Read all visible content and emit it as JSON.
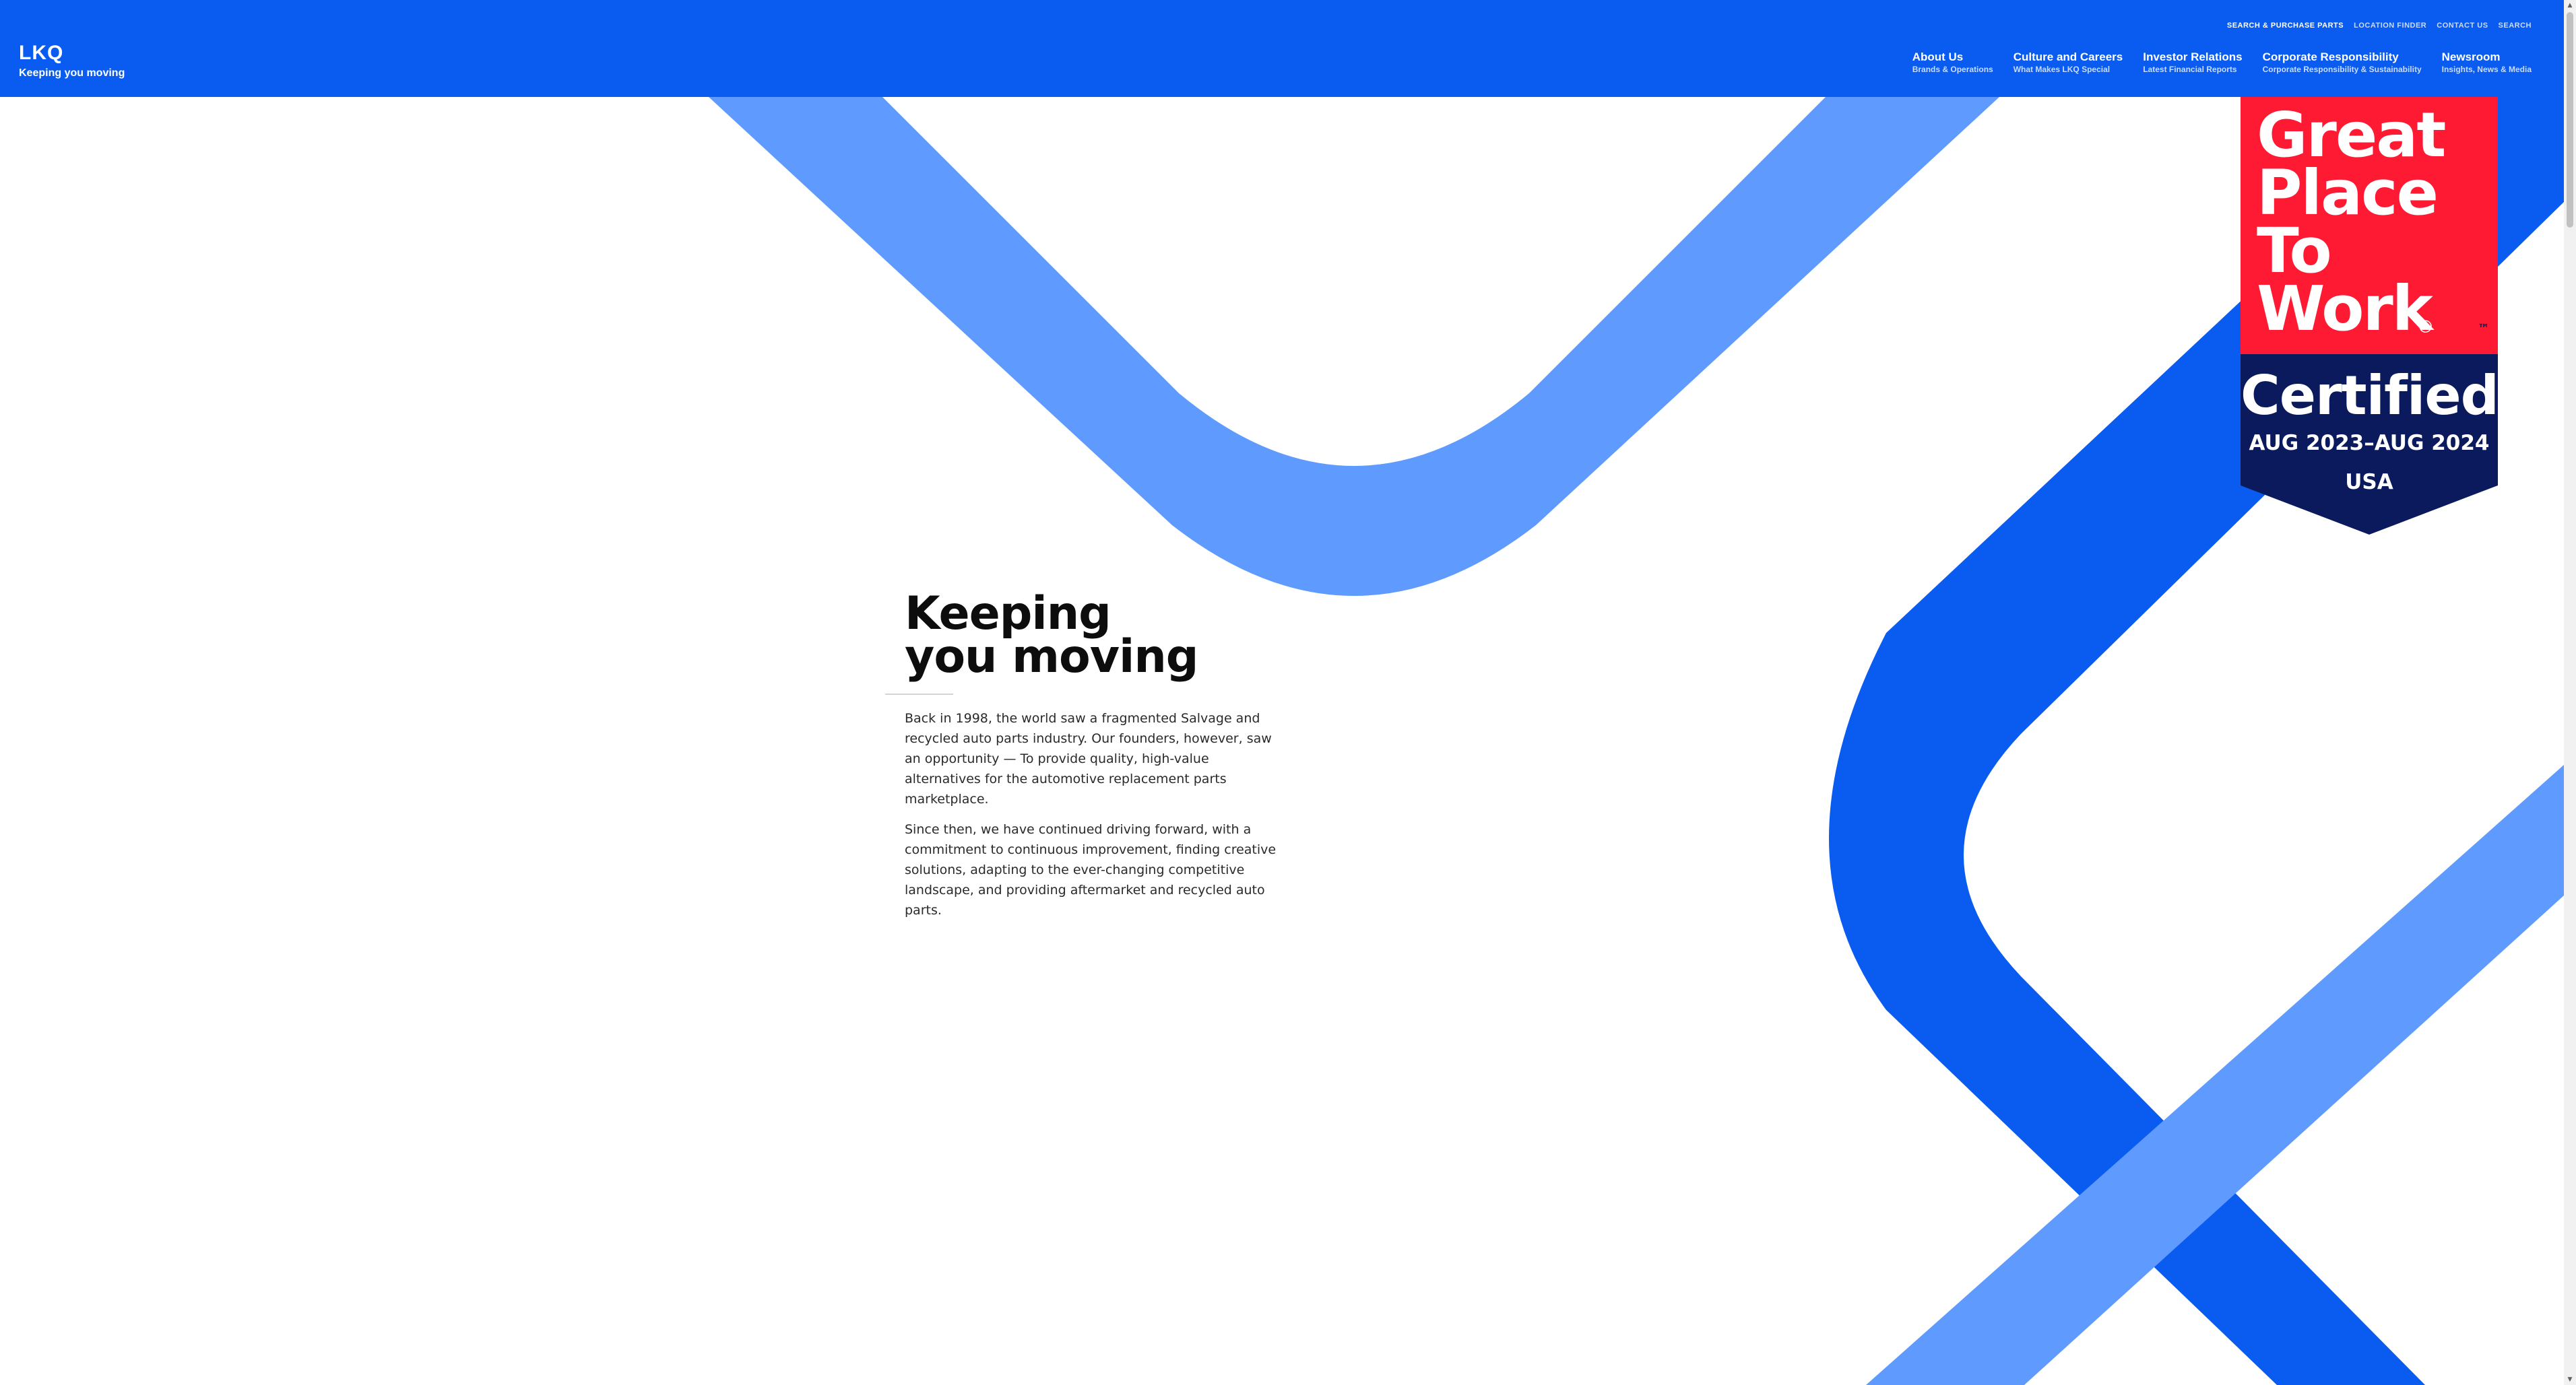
{
  "colors": {
    "header_bg": "#0a5cf0",
    "ribbon_dark": "#0a5cf0",
    "ribbon_light": "#5f9bff",
    "badge_red": "#ff1a33",
    "badge_navy": "#0a1a5c",
    "page_bg": "#ffffff"
  },
  "brand": {
    "logo": "LKQ",
    "tagline": "Keeping you moving"
  },
  "utility_nav": [
    {
      "label": "SEARCH & PURCHASE PARTS"
    },
    {
      "label": "LOCATION FINDER"
    },
    {
      "label": "CONTACT US"
    },
    {
      "label": "SEARCH"
    }
  ],
  "main_nav": [
    {
      "label": "About Us",
      "sub": "Brands & Operations"
    },
    {
      "label": "Culture and Careers",
      "sub": "What Makes LKQ Special"
    },
    {
      "label": "Investor Relations",
      "sub": "Latest Financial Reports"
    },
    {
      "label": "Corporate Responsibility",
      "sub": "Corporate Responsibility & Sustainability"
    },
    {
      "label": "Newsroom",
      "sub": "Insights, News & Media"
    }
  ],
  "badge": {
    "line1": "Great",
    "line2": "Place",
    "line3": "To",
    "line4": "Work",
    "registered": "®",
    "certified": "Certified",
    "dates": "AUG 2023–AUG 2024",
    "country": "USA",
    "trademark": "™"
  },
  "hero": {
    "title_line1": "Keeping",
    "title_line2": "you moving",
    "paragraph1": "Back in 1998, the world saw a fragmented Salvage and recycled auto parts industry. Our founders, however, saw an opportunity — To provide quality, high-value alternatives for the automotive replacement parts marketplace.",
    "paragraph2": "Since then, we have continued driving forward, with a commitment to continuous improvement, finding creative solutions, adapting to the ever-changing competitive landscape, and providing aftermarket and recycled auto parts."
  },
  "icons": {
    "scroll_up": "scroll-up-arrow-icon",
    "scroll_down": "scroll-down-arrow-icon"
  }
}
